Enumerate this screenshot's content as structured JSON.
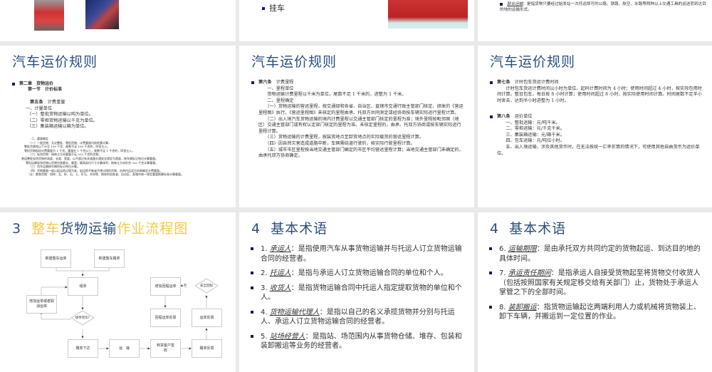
{
  "row1": {
    "slide_a": {
      "images": [
        "fire-truck",
        "tanker-truck"
      ]
    },
    "slide_b": {
      "bullet": "挂车",
      "image": "red-container-truck"
    },
    "slide_c": {
      "term": "联合运输",
      "text": "：是指货物只要经过始发站一次托运即可的公路、铁路、航空、水路等两种以上交通工具的运送而到达目的地的运输形式。"
    }
  },
  "slide1": {
    "title": "汽车运价规则",
    "chapter": "第二章　货物运价",
    "section": "第一节　计价标准",
    "article_label": "第五条",
    "article_title": "计费重量",
    "lines": [
      "一、计量单位",
      "（一）整批货物运输以吨为单位。",
      "（二）零担货物运输以千克为单位。",
      "（三）集装箱运输以箱为单位。"
    ],
    "small_lines": [
      "二、重量确定",
      "（一）一般货物：无论整批、零担货物，计费重量均按毛重计算。",
      "整批货物吨以下计至 100 千克，尾数不足 100 千克的，四舍五入。",
      "零担货物起码计费重量为 1 千克。重量在 1 千克以上，尾数不足 1 千克的，四舍五入。",
      "（二）轻泡货物：指每立方米重量不足 333 千克的货物。",
      "装运整批轻泡货物的高度、长度、宽度，以不超过有关道路交通安全规定为限度，按车辆标记吨位计算重量。",
      "零担运输轻泡货物以货物包装最长、最宽、最高部位尺寸计算体积，按每立方米折合 333 千克计算重量。",
      "（三）包车运输按车辆的标记吨位计算。",
      "（四）货物重量一般以起运地过磅为准。起运地不能或不便过磅的货物，由承托运双方协商确定计费重量。",
      "（五）散装货物：如砖、瓦、砂、石、土、矿石、木材等，按体积由各省、自治区、直辖市统一规定重量换算标准计算重量。"
    ]
  },
  "slide2": {
    "title": "汽车运价规则",
    "article_label": "第六条",
    "article_title": "计费里程",
    "lines": [
      "　　一、里程单位",
      "　　货物运输计费里程以千米为单位，尾数不足 1 千米的，进整为 1 千米。",
      "　　二、里程确定",
      "　　（一）货物运输的营运里程，按交通部和各省、自治区、直辖市交通行政主管部门核定、颁发的《营运里程图》执行。《营运里程图》未核定的里程由承、托双方共同测定或经协商按车辆实际运行里程计算。",
      "　　（二）出入境汽车货物运输的境内计费里程以交通主管部门核定的里程为准；境外里程按毗邻国（地区）交通主管部门或有权认定部门核定的里程为准。未核定里程的，由承、托双方协商或按车辆实际运行里程计算。",
      "　　（三）货物运输的计费里程，按装货地点至卸货地点的实际载货的营运里程计算。",
      "　　（四）因自然灾害造成道路中断，车辆需绕道行驶的，按实际行驶里程计算。",
      "　　（五）城市市区里程按当地交通主管部门确定的市区平均营运里程计算；当地交通主管部门未确定的，由承托双方协商确定。"
    ]
  },
  "slide3": {
    "title": "汽车运价规则",
    "art7_label": "第七条",
    "art7_title": "计时包车货运计费时间",
    "art7_text": "　　计时包车货运计费时间以小时为单位。起码计费时间为 4 小时；使用时间超过 4 小时，按实际包用时间计算。整日包车，每日按 8 小时计算；使用时间超过 8 小时，按实际使用时间计算。时间尾数不足半小时舍去，达到半小时进整为 1 小时。",
    "art8_label": "第八条",
    "art8_title": "运价单位",
    "art8_lines": [
      "　　一、整批运输：元/吨千米。",
      "　　二、零担运输：元/千克千米。",
      "　　三、集装箱运输：元/箱千米。",
      "　　四、包车运输：元/吨位小时。",
      "　　五、出入境运输，涉及其他货币时，在无法按统一汇率折算的情况下，可使用其他自由货币为运价单位。"
    ]
  },
  "slide4": {
    "title_num": "3",
    "title_parts": [
      "整车",
      "货物运输",
      "作业流程图"
    ],
    "colors": {
      "yellow": "#f2c94c",
      "blue": "#2d4f7c"
    },
    "flow": {
      "new_waybill": "新建整车运单",
      "new_roadbill": "新建整车路单",
      "group": "组单",
      "add_cancel": "增加运单或者取消运单",
      "group_done": "组单完毕?",
      "dispatch": "路单下达",
      "transport": "运　输",
      "arrive": "到货客户签收",
      "road_feedback": "路单反馈",
      "waybill_feedback": "运单反馈",
      "safe_return": "安全回程",
      "no": "否",
      "add_return": "增加回程运单",
      "return_feedback": "回程运单反馈"
    }
  },
  "slide5": {
    "title": "4  基本术语",
    "items": [
      {
        "num": "1.",
        "term": "承运人",
        "text": "：是指使用汽车从事货物运输并与托运人订立货物运输合同的经营者。"
      },
      {
        "num": "2.",
        "term": "托运人",
        "text": "：是指与承运人订立货物运输合同的单位和个人。"
      },
      {
        "num": "3.",
        "term": "收货人",
        "text": "：是指货物运输合同中托运人指定提取货物的单位和个人。"
      },
      {
        "num": "4.",
        "term": "货物运输代理人",
        "text": "：是指以自己的名义承揽货物并分别与托运人、承运人订立货物运输合同的经营者。"
      },
      {
        "num": "5.",
        "term": "站场经营人",
        "text": "：是指站、场范围内从事货物仓储、堆存、包装和装卸搬运等业务的经营者。"
      }
    ]
  },
  "slide6": {
    "title": "4  基本术语",
    "items": [
      {
        "num": "6.",
        "term": "运输期限",
        "text": "：是由承托双方共同约定的货物起运、到达目的地的具体时间。"
      },
      {
        "num": "7.",
        "term": "承运责任期间",
        "text": "：是指承运人自接受货物起至将货物交付收货人（包括按照国家有关规定移交给有关部门）止，货物处于承运人掌管之下的全部时间。"
      },
      {
        "num": "8.",
        "term": "装卸搬运",
        "text": "：指货物运输起讫两端利用人力或机械将货物装上、卸下车辆，并搬运到一定位置的作业。"
      }
    ]
  }
}
